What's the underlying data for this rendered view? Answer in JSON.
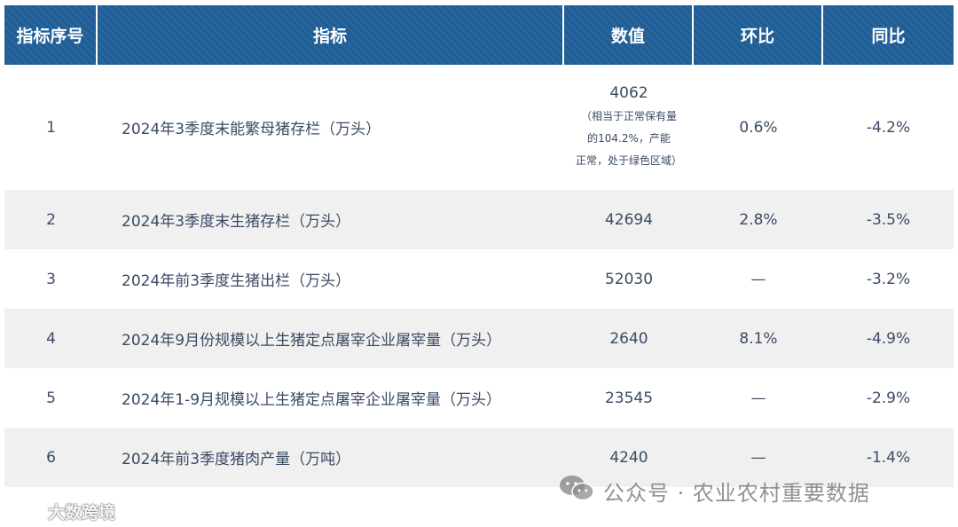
{
  "table": {
    "headers": [
      "指标序号",
      "指标",
      "数值",
      "环比",
      "同比"
    ],
    "rows": [
      {
        "no": "1",
        "name": "2024年3季度末能繁母猪存栏（万头）",
        "value": "4062",
        "note_lines": [
          "（相当于正常保有量",
          "的104.2%，产能",
          "正常，处于绿色区域）"
        ],
        "mom": "0.6%",
        "yoy": "-4.2%"
      },
      {
        "no": "2",
        "name": "2024年3季度末生猪存栏（万头）",
        "value": "42694",
        "mom": "2.8%",
        "yoy": "-3.5%"
      },
      {
        "no": "3",
        "name": "2024年前3季度生猪出栏（万头）",
        "value": "52030",
        "mom": "—",
        "yoy": "-3.2%"
      },
      {
        "no": "4",
        "name": "2024年9月份规模以上生猪定点屠宰企业屠宰量（万头）",
        "value": "2640",
        "mom": "8.1%",
        "yoy": "-4.9%"
      },
      {
        "no": "5",
        "name": "2024年1-9月规模以上生猪定点屠宰企业屠宰量（万头）",
        "value": "23545",
        "mom": "—",
        "yoy": "-2.9%"
      },
      {
        "no": "6",
        "name": "2024年前3季度猪肉产量（万吨）",
        "value": "4240",
        "mom": "—",
        "yoy": "-1.4%"
      }
    ]
  },
  "watermarks": {
    "left_text": "大数跨境",
    "left_icon": "brand-logo-icon",
    "right_text": "公众号 · 农业农村重要数据",
    "right_icon": "wechat-icon"
  },
  "colors": {
    "header_bg": "#1f5e96",
    "alt_row_bg": "#f0f0f0",
    "text": "#3a4b63"
  }
}
